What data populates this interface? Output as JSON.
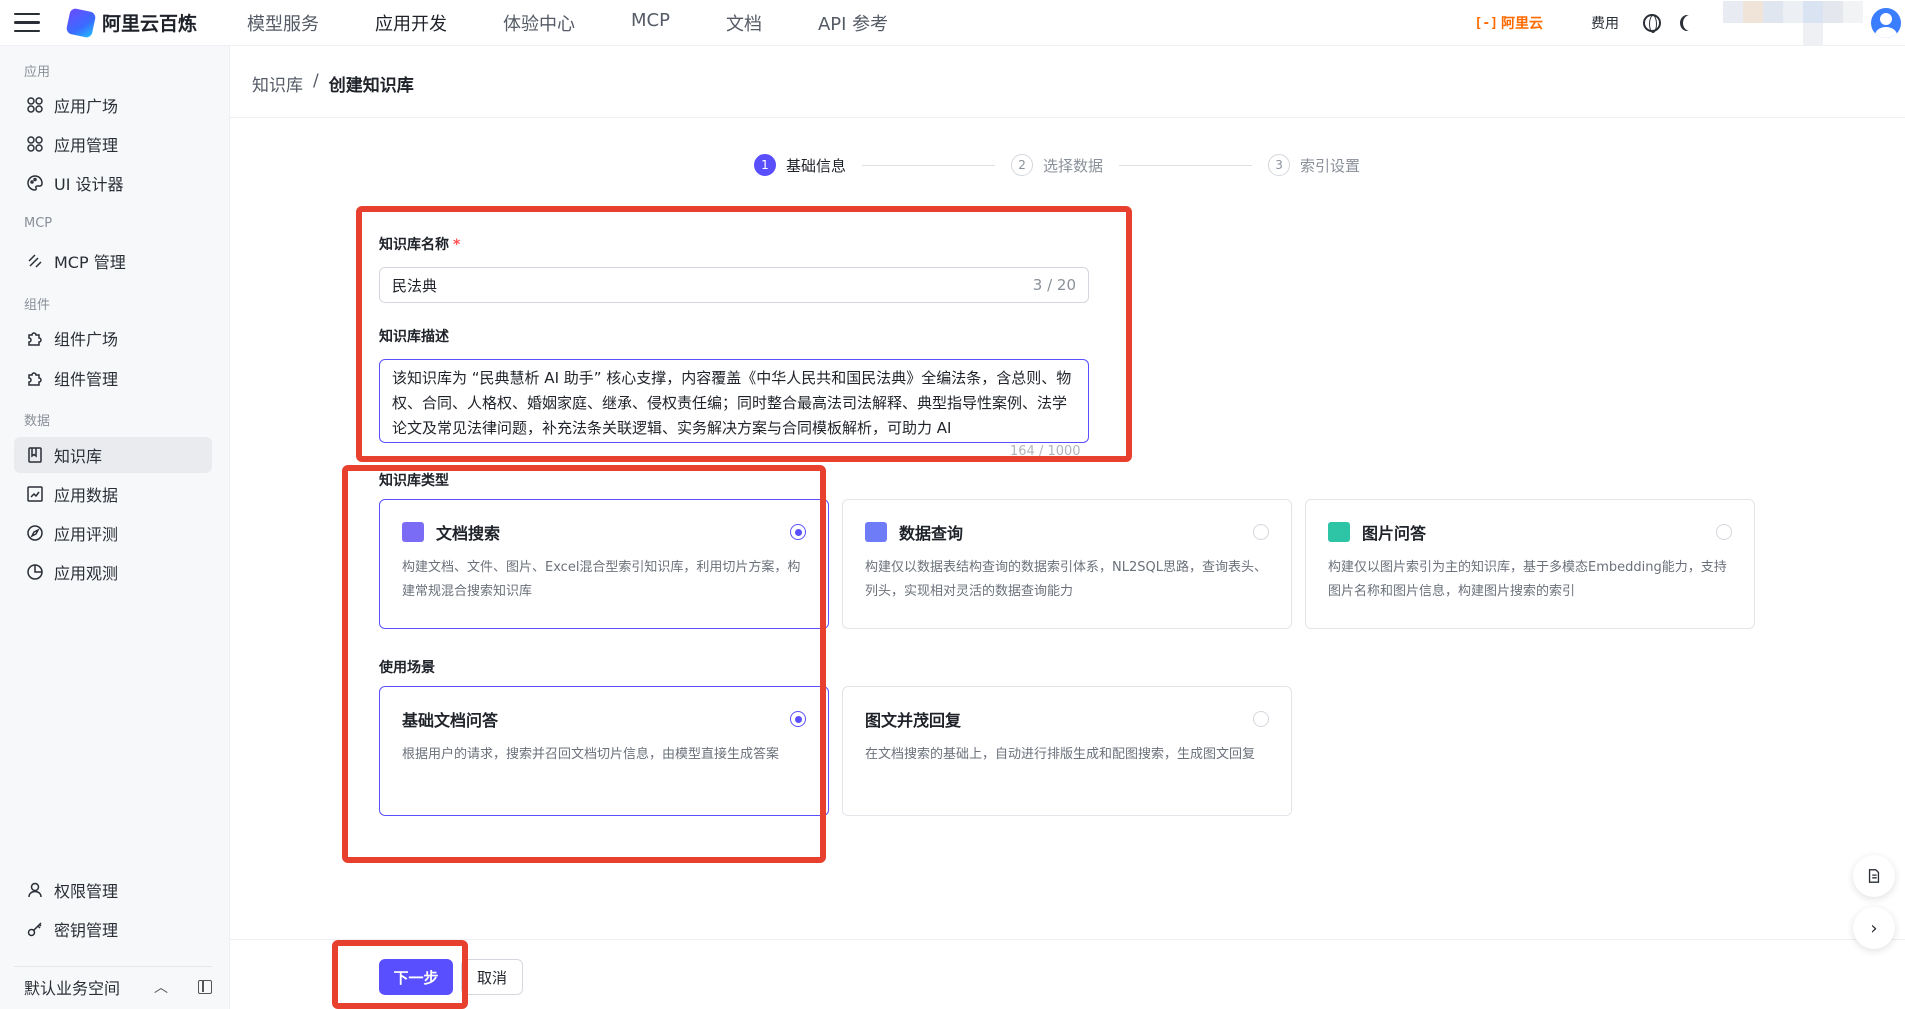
{
  "topbar": {
    "brand": "阿里云百炼",
    "nav": [
      "模型服务",
      "应用开发",
      "体验中心",
      "MCP",
      "文档",
      "API 参考"
    ],
    "active_nav": "应用开发",
    "aliyun": "阿里云",
    "aliyun_mark": "[-]",
    "fee": "费用"
  },
  "sidebar": {
    "groups": {
      "app": "应用",
      "mcp": "MCP",
      "component": "组件",
      "data": "数据"
    },
    "items": {
      "app_square": "应用广场",
      "app_manage": "应用管理",
      "ui_designer": "UI 设计器",
      "mcp_manage": "MCP 管理",
      "comp_square": "组件广场",
      "comp_manage": "组件管理",
      "knowledge": "知识库",
      "app_data": "应用数据",
      "app_eval": "应用评测",
      "app_observe": "应用观测",
      "permission": "权限管理",
      "secret": "密钥管理"
    },
    "active": "knowledge",
    "workspace": "默认业务空间"
  },
  "breadcrumb": {
    "parent": "知识库",
    "sep": "/",
    "current": "创建知识库"
  },
  "steps": [
    {
      "num": "1",
      "label": "基础信息"
    },
    {
      "num": "2",
      "label": "选择数据"
    },
    {
      "num": "3",
      "label": "索引设置"
    }
  ],
  "form": {
    "name_label": "知识库名称",
    "required_mark": "*",
    "name_value": "民法典",
    "name_count": "3 / 20",
    "desc_label": "知识库描述",
    "desc_value": "该知识库为 “民典慧析 AI 助手” 核心支撑，内容覆盖《中华人民共和国民法典》全编法条，含总则、物权、合同、人格权、婚姻家庭、继承、侵权责任编；同时整合最高法司法解释、典型指导性案例、法学论文及常见法律问题，补充法条关联逻辑、实务解决方案与合同模板解析，可助力 AI",
    "desc_count": "164 / 1000",
    "type_label": "知识库类型",
    "scene_label": "使用场景"
  },
  "types": [
    {
      "title": "文档搜索",
      "desc": "构建文档、文件、图片、Excel混合型索引知识库，利用切片方案，构建常规混合搜索知识库",
      "selected": true,
      "icon": "doc-search-icon",
      "color": "#7b6cf6"
    },
    {
      "title": "数据查询",
      "desc": "构建仅以数据表结构查询的数据索引体系，NL2SQL思路，查询表头、列头，实现相对灵活的数据查询能力",
      "selected": false,
      "icon": "data-query-icon",
      "color": "#6e7cf7"
    },
    {
      "title": "图片问答",
      "desc": "构建仅以图片索引为主的知识库，基于多模态Embedding能力，支持图片名称和图片信息，构建图片搜索的索引",
      "selected": false,
      "icon": "image-qa-icon",
      "color": "#2ec4a6"
    }
  ],
  "scenes": [
    {
      "title": "基础文档问答",
      "desc": "根据用户的请求，搜索并召回文档切片信息，由模型直接生成答案",
      "selected": true
    },
    {
      "title": "图文并茂回复",
      "desc": "在文档搜索的基础上，自动进行排版生成和配图搜索，生成图文回复",
      "selected": false
    }
  ],
  "buttons": {
    "next": "下一步",
    "cancel": "取消"
  },
  "colors": {
    "accent": "#5a4fff",
    "highlight": "#e8402f",
    "brand_orange": "#ff6a00"
  }
}
